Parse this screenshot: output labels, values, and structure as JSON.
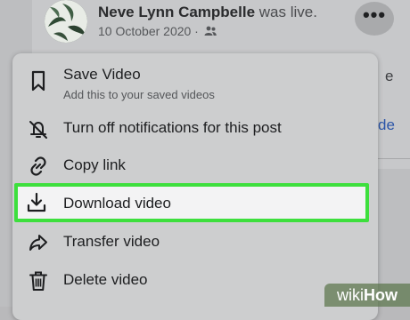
{
  "post": {
    "author": "Neve Lynn Campbelle",
    "action": " was live.",
    "date": "10 October 2020 · ",
    "audience_icon": "friends-icon",
    "more_icon": "ellipsis-icon",
    "more_label": "•••",
    "side_text_e": "e",
    "side_text_de": "de"
  },
  "menu": {
    "items": [
      {
        "label": "Save Video",
        "sub": "Add this to your saved videos",
        "icon": "bookmark-icon"
      },
      {
        "label": "Turn off notifications for this post",
        "icon": "bell-off-icon"
      },
      {
        "label": "Copy link",
        "icon": "link-icon"
      },
      {
        "label": "Download video",
        "icon": "download-icon"
      },
      {
        "label": "Transfer video",
        "icon": "share-arrow-icon"
      },
      {
        "label": "Delete video",
        "icon": "trash-icon"
      }
    ]
  },
  "colors": {
    "highlight_border": "#3ddf3d",
    "menu_bg": "#cdcecf",
    "link_blue": "#2b55a8"
  },
  "watermark": {
    "wiki": "wiki",
    "how": "How"
  }
}
